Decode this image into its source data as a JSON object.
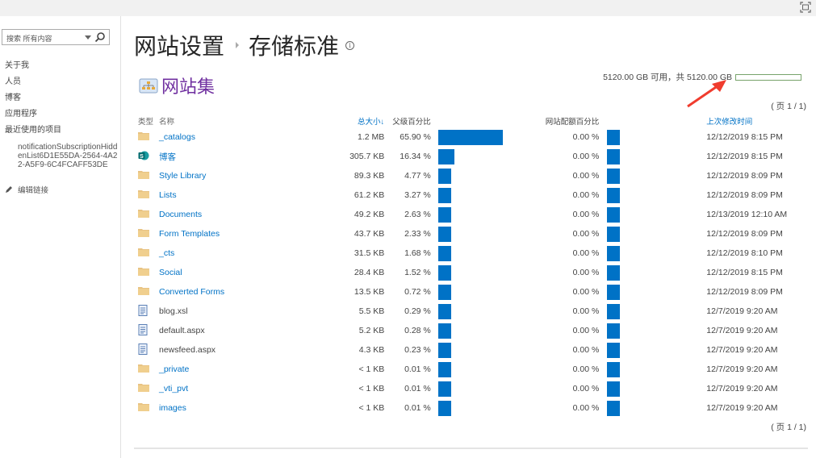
{
  "topbar": {
    "focus_icon": "focus-mode-icon"
  },
  "sidebar": {
    "search_placeholder": "搜索 所有内容",
    "nav_items": [
      {
        "label": "关于我"
      },
      {
        "label": "人员"
      },
      {
        "label": "博客"
      },
      {
        "label": "应用程序"
      },
      {
        "label": "最近使用的项目"
      }
    ],
    "recent_item": "notificationSubscriptionHiddenList6D1E55DA-2564-4A22-A5F9-6C4FCAFF53DE",
    "edit_links": "编辑链接"
  },
  "header": {
    "breadcrumb_parent": "网站设置",
    "breadcrumb_current": "存储标准",
    "section_title": "网站集"
  },
  "quota": {
    "text": "5120.00 GB 可用，共 5120.00 GB",
    "used_fraction": 0.0,
    "bar_border_color": "#77a36b"
  },
  "pager_top": "( 页 1 / 1)",
  "pager_bottom": "( 页 1 / 1)",
  "table": {
    "headers": {
      "type": "类型",
      "name": "名称",
      "size": "总大小↓",
      "parent_pct": "父级百分比",
      "quota_pct": "网站配额百分比",
      "modified": "上次修改时间"
    },
    "bar_color": "#0072c6",
    "rows": [
      {
        "icon": "folder",
        "name": "_catalogs",
        "link": true,
        "size": "1.2 MB",
        "parent_pct": "65.90 %",
        "parent_val": 65.9,
        "quota_pct": "0.00 %",
        "modified": "12/12/2019 8:15 PM"
      },
      {
        "icon": "sharepoint",
        "name": "博客",
        "link": true,
        "size": "305.7 KB",
        "parent_pct": "16.34 %",
        "parent_val": 16.34,
        "quota_pct": "0.00 %",
        "modified": "12/12/2019 8:15 PM"
      },
      {
        "icon": "folder",
        "name": "Style Library",
        "link": true,
        "size": "89.3 KB",
        "parent_pct": "4.77 %",
        "parent_val": 4.77,
        "quota_pct": "0.00 %",
        "modified": "12/12/2019 8:09 PM"
      },
      {
        "icon": "folder",
        "name": "Lists",
        "link": true,
        "size": "61.2 KB",
        "parent_pct": "3.27 %",
        "parent_val": 3.27,
        "quota_pct": "0.00 %",
        "modified": "12/12/2019 8:09 PM"
      },
      {
        "icon": "folder",
        "name": "Documents",
        "link": true,
        "size": "49.2 KB",
        "parent_pct": "2.63 %",
        "parent_val": 2.63,
        "quota_pct": "0.00 %",
        "modified": "12/13/2019 12:10 AM"
      },
      {
        "icon": "folder",
        "name": "Form Templates",
        "link": true,
        "size": "43.7 KB",
        "parent_pct": "2.33 %",
        "parent_val": 2.33,
        "quota_pct": "0.00 %",
        "modified": "12/12/2019 8:09 PM"
      },
      {
        "icon": "folder",
        "name": "_cts",
        "link": true,
        "size": "31.5 KB",
        "parent_pct": "1.68 %",
        "parent_val": 1.68,
        "quota_pct": "0.00 %",
        "modified": "12/12/2019 8:10 PM"
      },
      {
        "icon": "folder",
        "name": "Social",
        "link": true,
        "size": "28.4 KB",
        "parent_pct": "1.52 %",
        "parent_val": 1.52,
        "quota_pct": "0.00 %",
        "modified": "12/12/2019 8:15 PM"
      },
      {
        "icon": "folder",
        "name": "Converted Forms",
        "link": true,
        "size": "13.5 KB",
        "parent_pct": "0.72 %",
        "parent_val": 0.72,
        "quota_pct": "0.00 %",
        "modified": "12/12/2019 8:09 PM"
      },
      {
        "icon": "document",
        "name": "blog.xsl",
        "link": false,
        "size": "5.5 KB",
        "parent_pct": "0.29 %",
        "parent_val": 0.29,
        "quota_pct": "0.00 %",
        "modified": "12/7/2019 9:20 AM"
      },
      {
        "icon": "document",
        "name": "default.aspx",
        "link": false,
        "size": "5.2 KB",
        "parent_pct": "0.28 %",
        "parent_val": 0.28,
        "quota_pct": "0.00 %",
        "modified": "12/7/2019 9:20 AM"
      },
      {
        "icon": "document",
        "name": "newsfeed.aspx",
        "link": false,
        "size": "4.3 KB",
        "parent_pct": "0.23 %",
        "parent_val": 0.23,
        "quota_pct": "0.00 %",
        "modified": "12/7/2019 9:20 AM"
      },
      {
        "icon": "folder",
        "name": "_private",
        "link": true,
        "size": "< 1 KB",
        "parent_pct": "0.01 %",
        "parent_val": 0.01,
        "quota_pct": "0.00 %",
        "modified": "12/7/2019 9:20 AM"
      },
      {
        "icon": "folder",
        "name": "_vti_pvt",
        "link": true,
        "size": "< 1 KB",
        "parent_pct": "0.01 %",
        "parent_val": 0.01,
        "quota_pct": "0.00 %",
        "modified": "12/7/2019 9:20 AM"
      },
      {
        "icon": "folder",
        "name": "images",
        "link": true,
        "size": "< 1 KB",
        "parent_pct": "0.01 %",
        "parent_val": 0.01,
        "quota_pct": "0.00 %",
        "modified": "12/7/2019 9:20 AM"
      }
    ]
  }
}
